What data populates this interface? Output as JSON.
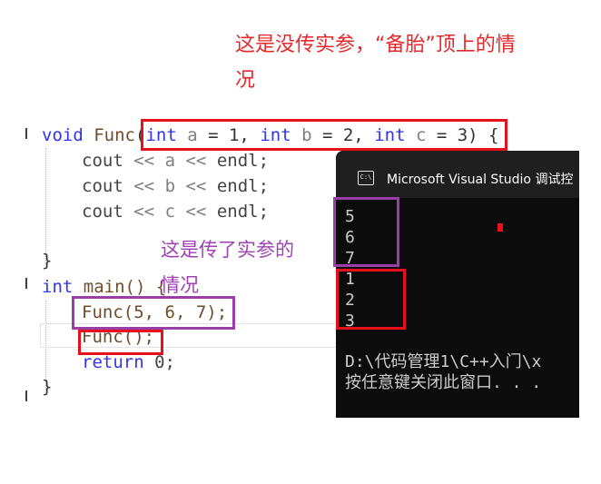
{
  "annotations": {
    "red_note_line1": "这是没传实参，“备胎”顶上的情",
    "red_note_line2": "况",
    "purple_note_line1": "这是传了实参的",
    "purple_note_line2": "情况"
  },
  "code": {
    "line1": {
      "kw_void": "void",
      "fn_name": "Func",
      "paren_open": "(",
      "kw_int1": "int",
      "p_a": "a",
      "eq1": " = 1, ",
      "kw_int2": "int",
      "p_b": "b",
      "eq2": " = 2, ",
      "kw_int3": "int",
      "p_c": "c",
      "eq3": " = 3) {"
    },
    "cout_a": {
      "cout": "cout",
      "op1": "<<",
      "var": "a",
      "op2": "<<",
      "endl": "endl;"
    },
    "cout_b": {
      "cout": "cout",
      "op1": "<<",
      "var": "b",
      "op2": "<<",
      "endl": "endl;"
    },
    "cout_c": {
      "cout": "cout",
      "op1": "<<",
      "var": "c",
      "op2": "<<",
      "endl": "endl;"
    },
    "close_brace1": "}",
    "main_line": {
      "kw_int": "int",
      "main": "main() {"
    },
    "call_with_args": "Func(5, 6, 7);",
    "call_no_args": "Func();",
    "return_line": {
      "kw": "return",
      "val": "0;"
    },
    "close_brace2": "}"
  },
  "console": {
    "title": "Microsoft Visual Studio 调试控",
    "icon_label": "C:\\",
    "output": [
      "5",
      "6",
      "7",
      "1",
      "2",
      "3"
    ],
    "path_line": "D:\\代码管理1\\C++入门\\x",
    "exit_prompt": "按任意键关闭此窗口. . ."
  },
  "colors": {
    "annotation_red": "#e8272a",
    "annotation_purple": "#a040b4",
    "keyword_blue": "#3333e8",
    "console_bg": "#0c0c0c"
  }
}
